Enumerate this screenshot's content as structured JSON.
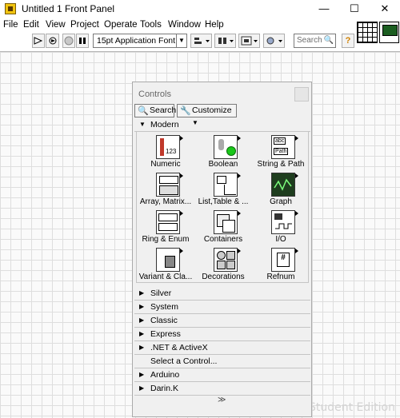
{
  "window": {
    "title": "Untitled 1 Front Panel",
    "minimize_glyph": "—",
    "maximize_glyph": "☐",
    "close_glyph": "✕"
  },
  "menu": [
    "File",
    "Edit",
    "View",
    "Project",
    "Operate",
    "Tools",
    "Window",
    "Help"
  ],
  "toolbar": {
    "font_value": "15pt Application Font",
    "search_placeholder": "Search",
    "help_glyph": "?"
  },
  "palette": {
    "title": "Controls",
    "search_label": "Search",
    "customize_label": "Customize",
    "open_category": "Modern",
    "items": [
      {
        "label": "Numeric",
        "icon": "numeric-icon"
      },
      {
        "label": "Boolean",
        "icon": "boolean-icon"
      },
      {
        "label": "String & Path",
        "icon": "string-path-icon"
      },
      {
        "label": "Array, Matrix...",
        "icon": "array-matrix-icon"
      },
      {
        "label": "List,Table & ...",
        "icon": "list-table-icon"
      },
      {
        "label": "Graph",
        "icon": "graph-icon"
      },
      {
        "label": "Ring & Enum",
        "icon": "ring-enum-icon"
      },
      {
        "label": "Containers",
        "icon": "containers-icon"
      },
      {
        "label": "I/O",
        "icon": "io-icon"
      },
      {
        "label": "Variant & Cla...",
        "icon": "variant-class-icon"
      },
      {
        "label": "Decorations",
        "icon": "decorations-icon"
      },
      {
        "label": "Refnum",
        "icon": "refnum-icon"
      }
    ],
    "categories": [
      "Silver",
      "System",
      "Classic",
      "Express",
      ".NET & ActiveX",
      "Select a Control...",
      "Arduino",
      "Darin.K"
    ]
  },
  "watermark": "LabVIEW Home and Student Edition"
}
